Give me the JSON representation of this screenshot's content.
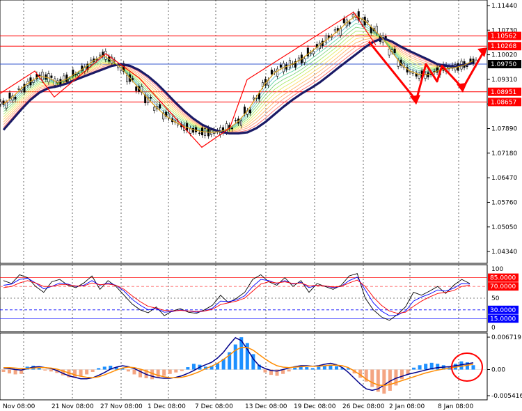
{
  "chart_data": [
    {
      "type": "line",
      "panel": "price",
      "y_ticks": [
        "1.11440",
        "1.10730",
        "1.10020",
        "1.09310",
        "1.08600",
        "1.07890",
        "1.07180",
        "1.06470",
        "1.05760",
        "1.05050",
        "1.04340"
      ],
      "ylim": [
        1.04,
        1.116
      ],
      "horizontal_levels": [
        {
          "label": "1.10562",
          "value": 1.10562,
          "color": "#ff0000"
        },
        {
          "label": "1.10268",
          "value": 1.10268,
          "color": "#ff0000"
        },
        {
          "label": "1.09750",
          "value": 1.0975,
          "color": "#000000"
        },
        {
          "label": "1.08951",
          "value": 1.08951,
          "color": "#ff0000"
        },
        {
          "label": "1.08657",
          "value": 1.08657,
          "color": "#ff0000"
        }
      ],
      "series": [
        {
          "color": "#1a1a66",
          "values": [
            1.0785,
            1.0815,
            1.0845,
            1.0872,
            1.0893,
            1.0906,
            1.0911,
            1.0919,
            1.093,
            1.094,
            1.095,
            1.096,
            1.097,
            1.0975,
            1.097,
            1.0958,
            1.094,
            1.0918,
            1.0892,
            1.0865,
            1.084,
            1.0818,
            1.08,
            1.0788,
            1.078,
            1.0775,
            1.0775,
            1.0778,
            1.079,
            1.0808,
            1.083,
            1.0852,
            1.0872,
            1.089,
            1.0905,
            1.0922,
            1.0942,
            1.0963,
            1.0983,
            1.1003,
            1.1023,
            1.104,
            1.105,
            1.104,
            1.1025,
            1.1012,
            1.1,
            1.0988,
            1.0975,
            1.097,
            1.0968,
            1.0973,
            1.0978
          ]
        },
        {
          "color": "#d4a017",
          "values": [
            1.086,
            1.088,
            1.0905,
            1.0925,
            1.094,
            1.0935,
            1.0922,
            1.0932,
            1.0948,
            1.0965,
            1.0985,
            1.1,
            1.0985,
            1.0965,
            1.0935,
            1.0905,
            1.0875,
            1.0848,
            1.0825,
            1.0808,
            1.0795,
            1.0786,
            1.078,
            1.0778,
            1.078,
            1.079,
            1.081,
            1.084,
            1.088,
            1.092,
            1.095,
            1.0965,
            1.0975,
            1.099,
            1.101,
            1.103,
            1.105,
            1.107,
            1.1095,
            1.1115,
            1.11,
            1.1075,
            1.1048,
            1.101,
            1.0975,
            1.0955,
            1.0945,
            1.0945,
            1.0955,
            1.0962,
            1.0965,
            1.0972,
            1.0985
          ]
        }
      ],
      "trend_arrows_color": "#ff0000"
    },
    {
      "type": "line",
      "panel": "stochastic",
      "y_ticks": [
        "100",
        "85.0000",
        "70.0000",
        "50",
        "30.0000",
        "15.0000",
        "0"
      ],
      "ylim": [
        0,
        100
      ],
      "levels": [
        85,
        70,
        30,
        15
      ],
      "series": [
        {
          "color": "#000000",
          "values": [
            80,
            75,
            90,
            85,
            70,
            60,
            78,
            82,
            72,
            68,
            76,
            88,
            65,
            80,
            70,
            55,
            40,
            30,
            25,
            35,
            20,
            28,
            32,
            26,
            24,
            30,
            38,
            55,
            42,
            50,
            60,
            82,
            90,
            78,
            72,
            85,
            70,
            80,
            60,
            75,
            70,
            65,
            72,
            88,
            92,
            50,
            30,
            18,
            12,
            22,
            35,
            60,
            55,
            62,
            70,
            58,
            72,
            82,
            75
          ]
        },
        {
          "color": "#0000ff",
          "values": [
            72,
            74,
            82,
            84,
            76,
            66,
            70,
            76,
            74,
            70,
            72,
            80,
            72,
            76,
            72,
            62,
            48,
            38,
            30,
            32,
            26,
            27,
            30,
            28,
            26,
            28,
            33,
            45,
            44,
            47,
            54,
            70,
            82,
            80,
            75,
            80,
            74,
            77,
            68,
            72,
            71,
            68,
            70,
            80,
            86,
            64,
            42,
            28,
            20,
            21,
            28,
            45,
            52,
            57,
            64,
            62,
            67,
            75,
            74
          ]
        },
        {
          "color": "#ff0000",
          "values": [
            68,
            70,
            76,
            80,
            76,
            70,
            70,
            73,
            73,
            71,
            71,
            76,
            73,
            74,
            72,
            65,
            54,
            44,
            36,
            33,
            29,
            28,
            29,
            28,
            27,
            28,
            31,
            39,
            42,
            45,
            50,
            62,
            74,
            78,
            76,
            78,
            75,
            76,
            71,
            72,
            71,
            69,
            70,
            76,
            81,
            70,
            52,
            38,
            28,
            24,
            26,
            36,
            45,
            52,
            58,
            60,
            63,
            70,
            72
          ]
        }
      ]
    },
    {
      "type": "bar",
      "panel": "macd",
      "y_ticks": [
        "0.006719",
        "0.00",
        "-0.005416"
      ],
      "ylim": [
        -0.005416,
        0.006719
      ],
      "histogram": [
        -0.0005,
        -0.0008,
        -0.001,
        -0.0009,
        0.0006,
        0.0008,
        0.0006,
        -0.0002,
        -0.0004,
        -0.0007,
        -0.0012,
        -0.0016,
        -0.0017,
        -0.0014,
        -0.001,
        -0.0005,
        0.0003,
        0.0006,
        0.0008,
        0.0005,
        0.0003,
        -0.0004,
        -0.001,
        -0.0016,
        -0.0018,
        -0.002,
        -0.0017,
        -0.0013,
        -0.0009,
        -0.0006,
        -0.0003,
        0.0005,
        0.0012,
        0.001,
        0.0006,
        0.0008,
        0.0013,
        0.0022,
        0.0036,
        0.0052,
        0.0067,
        0.0055,
        0.0032,
        0.001,
        -0.0006,
        -0.0011,
        -0.0013,
        -0.0009,
        -0.0004,
        0.0004,
        0.0007,
        0.0005,
        0.0003,
        0.0006,
        0.0008,
        0.001,
        0.0007,
        0.0004,
        0.0003,
        -0.0008,
        -0.0017,
        -0.0025,
        -0.0036,
        -0.0046,
        -0.005,
        -0.0044,
        -0.0033,
        -0.002,
        -0.001,
        0.0004,
        0.0009,
        0.0012,
        0.0014,
        0.0012,
        0.0009,
        0.0006,
        0.0012,
        0.0017,
        0.0015,
        0.0009
      ],
      "series": [
        {
          "color": "#00008b",
          "values": [
            0.0003,
            0.0002,
            0.0,
            -0.0001,
            0.0002,
            0.0005,
            0.0006,
            0.0004,
            0.0002,
            -0.0002,
            -0.0008,
            -0.0013,
            -0.0016,
            -0.0019,
            -0.0019,
            -0.0017,
            -0.0012,
            -0.0006,
            0.0001,
            0.0005,
            0.0008,
            0.0006,
            0.0002,
            -0.0004,
            -0.001,
            -0.0014,
            -0.0017,
            -0.0018,
            -0.0018,
            -0.0016,
            -0.0013,
            -0.0008,
            -0.0002,
            0.0005,
            0.001,
            0.0015,
            0.0024,
            0.0036,
            0.0052,
            0.0066,
            0.006,
            0.0042,
            0.0022,
            0.0008,
            0.0002,
            -0.0002,
            -0.0003,
            0.0,
            0.0003,
            0.0006,
            0.0008,
            0.0008,
            0.0007,
            0.0008,
            0.0011,
            0.0013,
            0.001,
            0.0004,
            -0.0006,
            -0.0018,
            -0.003,
            -0.004,
            -0.0043,
            -0.004,
            -0.0032,
            -0.0024,
            -0.0018,
            -0.0014,
            -0.001,
            -0.0007,
            -0.0004,
            -0.0001,
            0.0002,
            0.0004,
            0.0005,
            0.0006,
            0.0008,
            0.001,
            0.0012,
            0.0014
          ]
        },
        {
          "color": "#ff8c00",
          "values": [
            0.0004,
            0.0004,
            0.0003,
            0.0002,
            0.0002,
            0.0003,
            0.0004,
            0.0004,
            0.0003,
            0.0001,
            -0.0003,
            -0.0007,
            -0.0011,
            -0.0014,
            -0.0016,
            -0.0017,
            -0.0015,
            -0.0011,
            -0.0006,
            -0.0001,
            0.0003,
            0.0005,
            0.0004,
            0.0001,
            -0.0003,
            -0.0008,
            -0.0012,
            -0.0015,
            -0.0017,
            -0.0017,
            -0.0016,
            -0.0013,
            -0.0009,
            -0.0004,
            0.0002,
            0.0007,
            0.0013,
            0.0021,
            0.003,
            0.004,
            0.0046,
            0.0046,
            0.004,
            0.0031,
            0.0022,
            0.0014,
            0.0008,
            0.0005,
            0.0004,
            0.0005,
            0.0006,
            0.0007,
            0.0007,
            0.0007,
            0.0008,
            0.0009,
            0.0009,
            0.0008,
            0.0004,
            -0.0003,
            -0.0011,
            -0.002,
            -0.0027,
            -0.0032,
            -0.0033,
            -0.0031,
            -0.0027,
            -0.0023,
            -0.0019,
            -0.0015,
            -0.0011,
            -0.0007,
            -0.0004,
            -0.0001,
            0.0001,
            0.0003,
            0.0005,
            0.0007,
            0.0009,
            0.0011
          ]
        }
      ]
    }
  ],
  "x_ticks": [
    "Nov 08:00",
    "21 Nov 08:00",
    "27 Nov 08:00",
    "1 Dec 08:00",
    "7 Dec 08:00",
    "13 Dec 08:00",
    "19 Dec 08:00",
    "26 Dec 08:00",
    "2 Jan 08:00",
    "8 Jan 08:00"
  ],
  "colors": {
    "histogram_positive": "#1e90ff",
    "histogram_negative": "#f4a582",
    "highlight_circle": "#ff0000"
  }
}
